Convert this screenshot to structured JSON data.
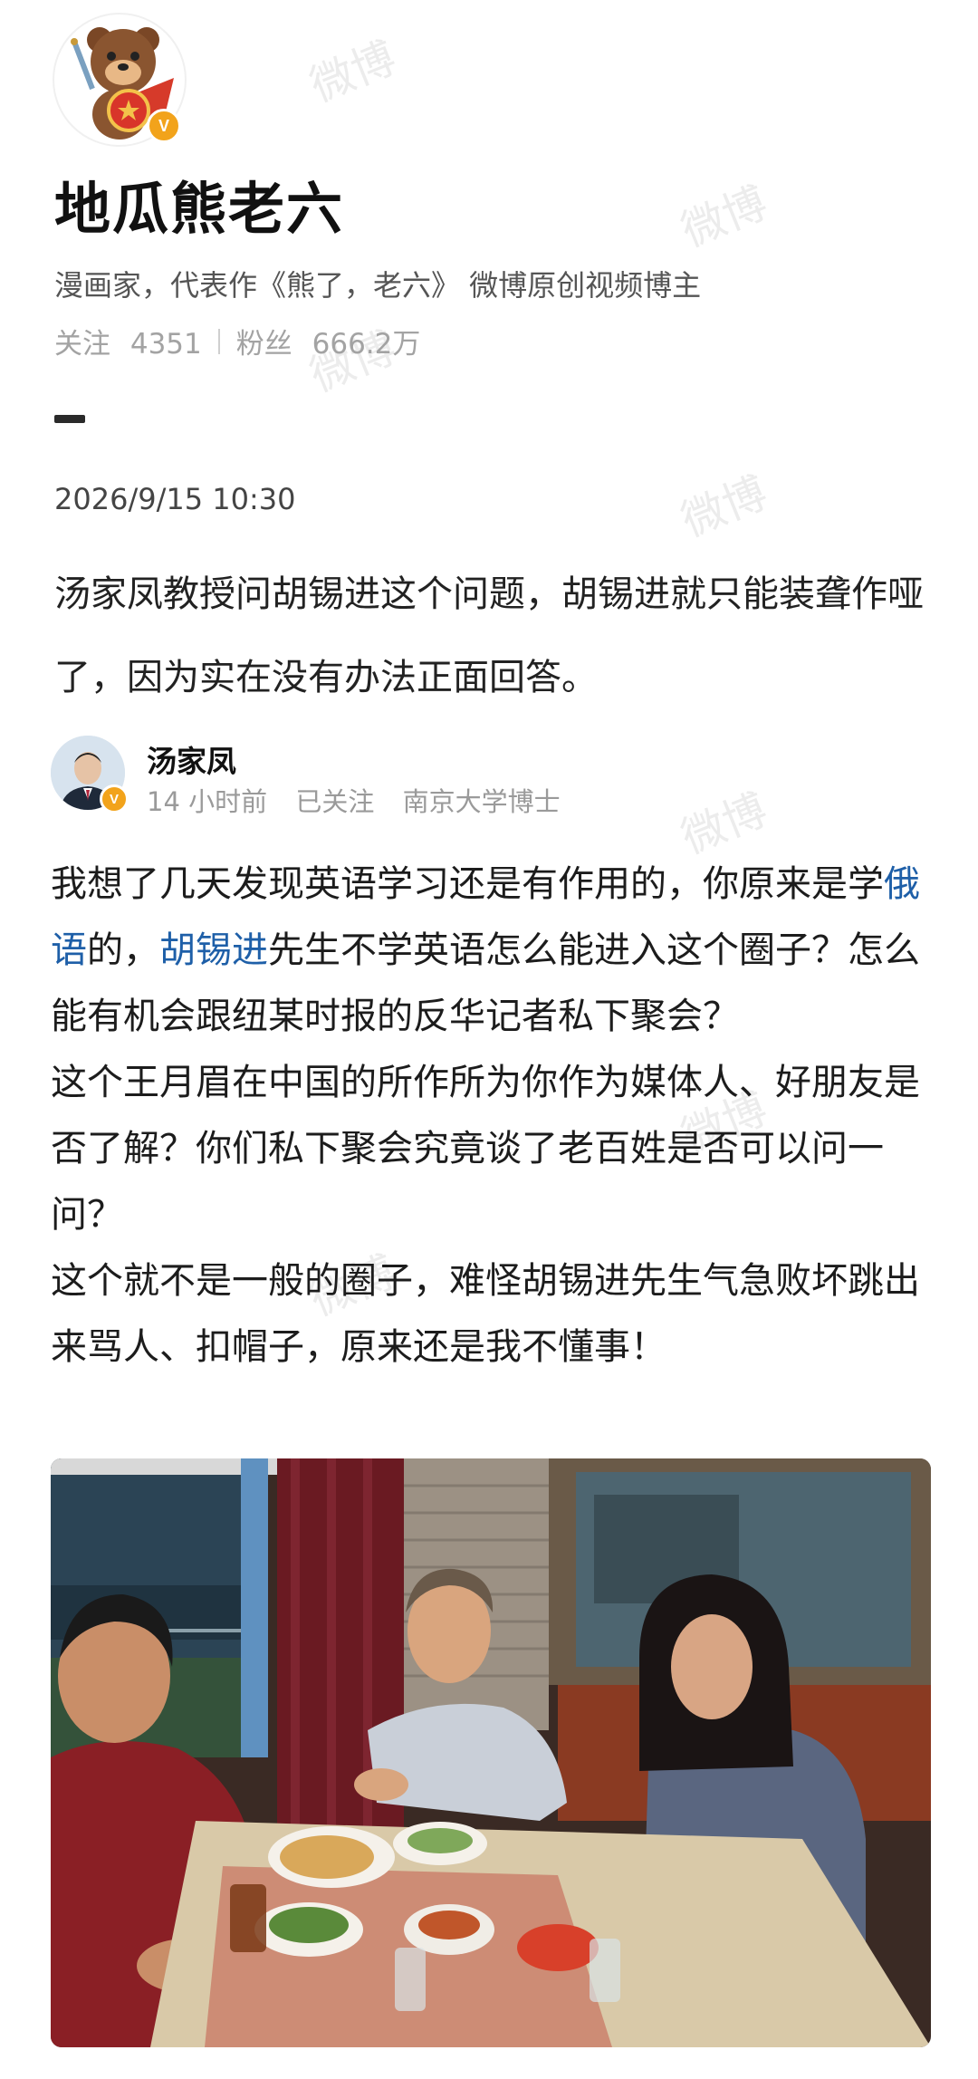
{
  "profile": {
    "name": "地瓜熊老六",
    "verified_badge": "V",
    "bio": "漫画家，代表作《熊了，老六》 微博原创视频博主",
    "following_label": "关注",
    "following_count": "4351",
    "followers_label": "粉丝",
    "followers_count": "666.2万"
  },
  "post": {
    "date": "2026/9/15 10:30",
    "text": "汤家凤教授问胡锡进这个问题，胡锡进就只能装聋作哑了，因为实在没有办法正面回答。"
  },
  "quoted": {
    "author": "汤家凤",
    "time": "14 小时前",
    "follow_status": "已关注",
    "affiliation": "南京大学博士",
    "para1_pre": "我想了几天发现英语学习还是有作用的，你原来是学",
    "para1_link1": "俄语",
    "para1_mid": "的，",
    "para1_link2": "胡锡进",
    "para1_post": "先生不学英语怎么能进入这个圈子？怎么能有机会跟纽某时报的反华记者私下聚会？",
    "para2": "这个王月眉在中国的所作所为你作为媒体人、好朋友是否了解？你们私下聚会究竟谈了老百姓是否可以问一问？",
    "para3": "这个就不是一般的圈子，难怪胡锡进先生气急败坏跳出来骂人、扣帽子，原来还是我不懂事！"
  },
  "watermark": "微博",
  "colors": {
    "link": "#1e5fa8",
    "badge": "#f2a31b"
  }
}
